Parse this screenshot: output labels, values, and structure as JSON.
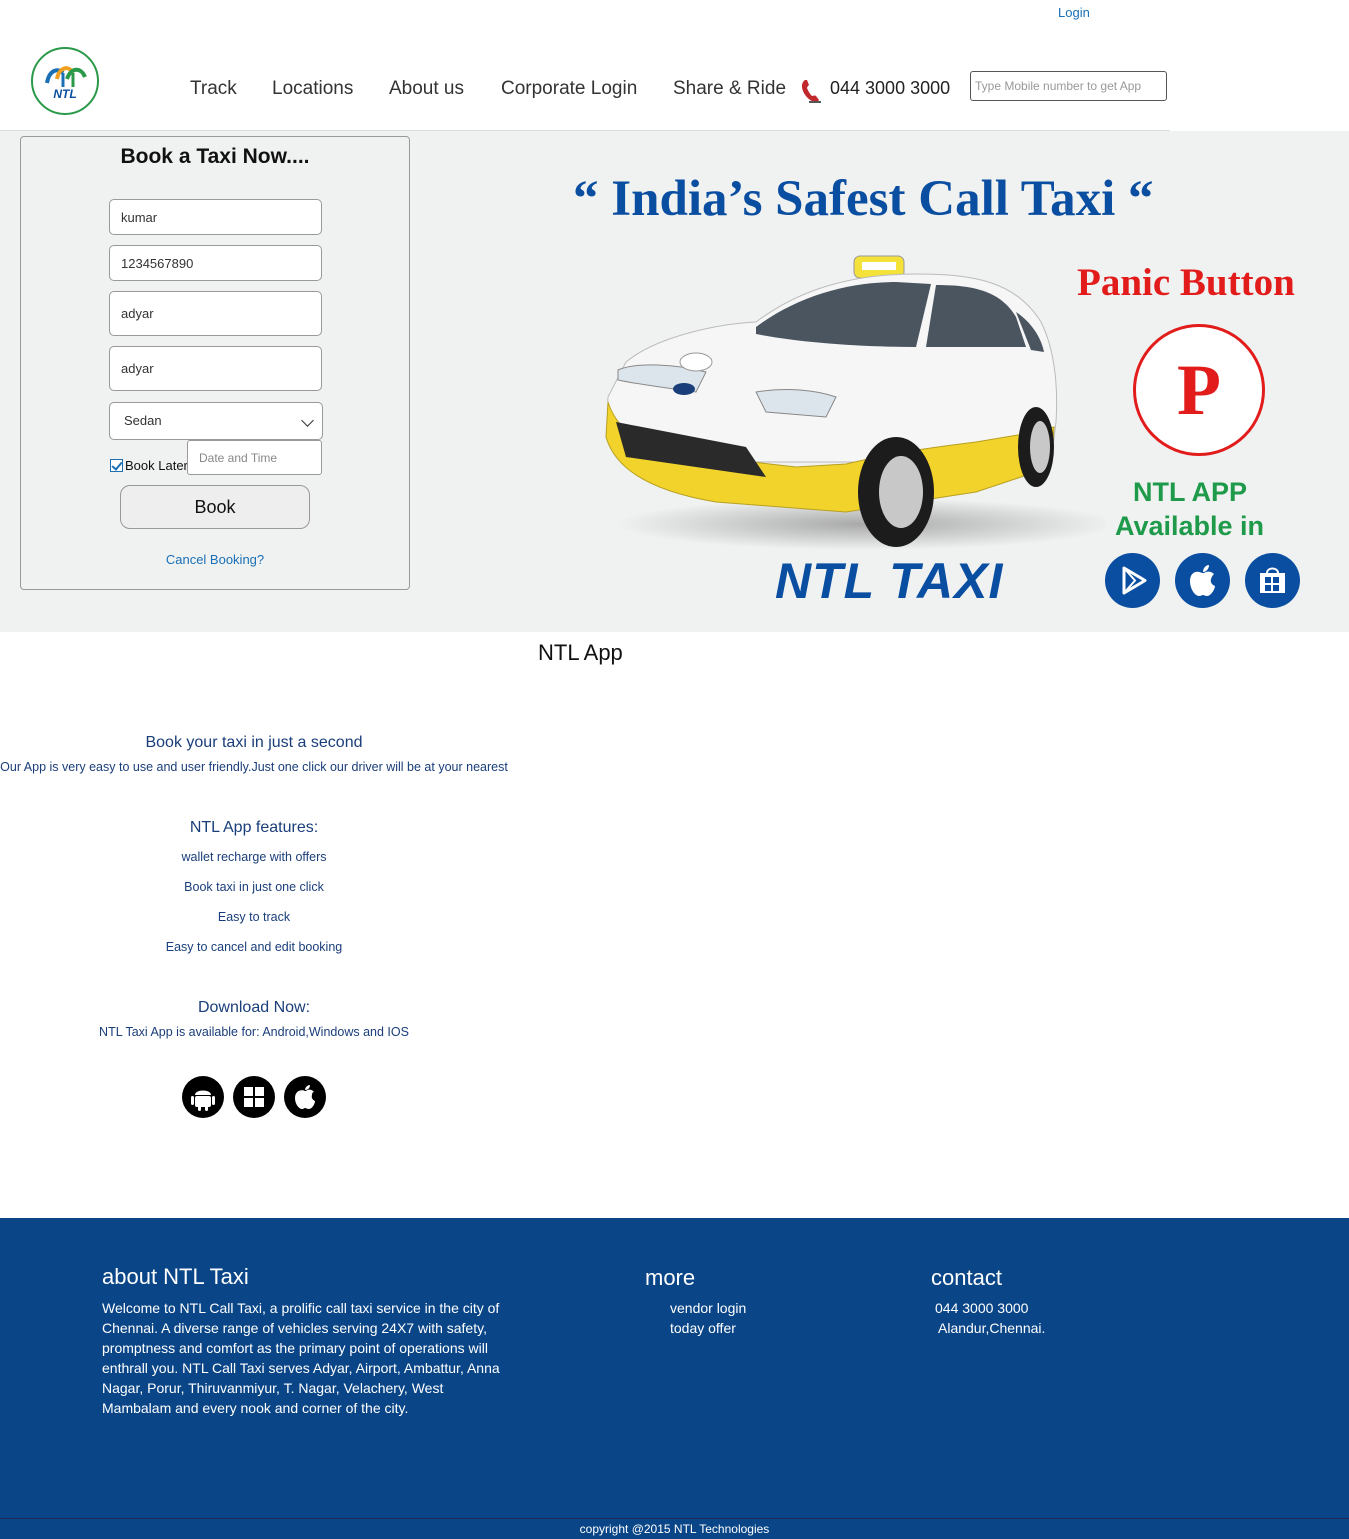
{
  "header": {
    "login_label": "Login",
    "logo_text": "NTL",
    "nav": [
      "Track",
      "Locations",
      "About us",
      "Corporate Login",
      "Share & Ride"
    ],
    "phone": "044 3000 3000",
    "app_input_placeholder": "Type Mobile number to get App"
  },
  "booking": {
    "title": "Book a Taxi Now....",
    "name_value": "kumar",
    "mobile_value": "1234567890",
    "pickup_value": "adyar",
    "drop_value": "adyar",
    "vehicle_selected": "Sedan",
    "book_later_label": "Book Later",
    "book_later_checked": true,
    "date_placeholder": "Date and Time",
    "book_button": "Book",
    "cancel_link": "Cancel Booking?"
  },
  "hero": {
    "tagline": "“ India’s Safest Call Taxi “",
    "brand_name": "NTL TAXI",
    "panic_title": "Panic Button",
    "panic_letter": "P",
    "app_available_line1": "NTL APP",
    "app_available_line2": "Available in",
    "store_icons": [
      "play-store-icon",
      "apple-icon",
      "windows-store-icon"
    ]
  },
  "app_section": {
    "title": "NTL App",
    "headline": "Book your taxi in just a second",
    "description": "Our App is very easy to use and user friendly.Just one click our driver will be at your nearest",
    "features_title": "NTL App features:",
    "features": [
      "wallet recharge with offers",
      "Book taxi in just one click",
      "Easy to track",
      "Easy to cancel and edit booking"
    ],
    "download_title": "Download Now:",
    "download_text": "NTL Taxi App is available for: Android,Windows and IOS",
    "download_icons": [
      "android-icon",
      "windows-icon",
      "apple-icon"
    ]
  },
  "footer": {
    "about_title": "about NTL Taxi",
    "about_text": "Welcome to NTL Call Taxi, a prolific call taxi service in the city of Chennai. A diverse range of vehicles serving 24X7 with safety, promptness and comfort as the primary point of operations will enthrall you. NTL Call Taxi serves Adyar, Airport, Ambattur, Anna Nagar, Porur, Thiruvanmiyur, T. Nagar, Velachery, West Mambalam and every nook and corner of the city.",
    "more_title": "more",
    "more_links": [
      "vendor login",
      "today offer"
    ],
    "contact_title": "contact",
    "contact_phone": "044 3000 3000",
    "contact_address": "Alandur,Chennai.",
    "copyright": "copyright @2015 NTL Technologies"
  },
  "colors": {
    "brand_blue": "#0a4ea1",
    "footer_blue": "#0a4687",
    "panic_red": "#e21b1b",
    "app_green": "#1e9a4a",
    "hero_bg": "#f0f2f1",
    "link_blue": "#1a6fb5"
  }
}
